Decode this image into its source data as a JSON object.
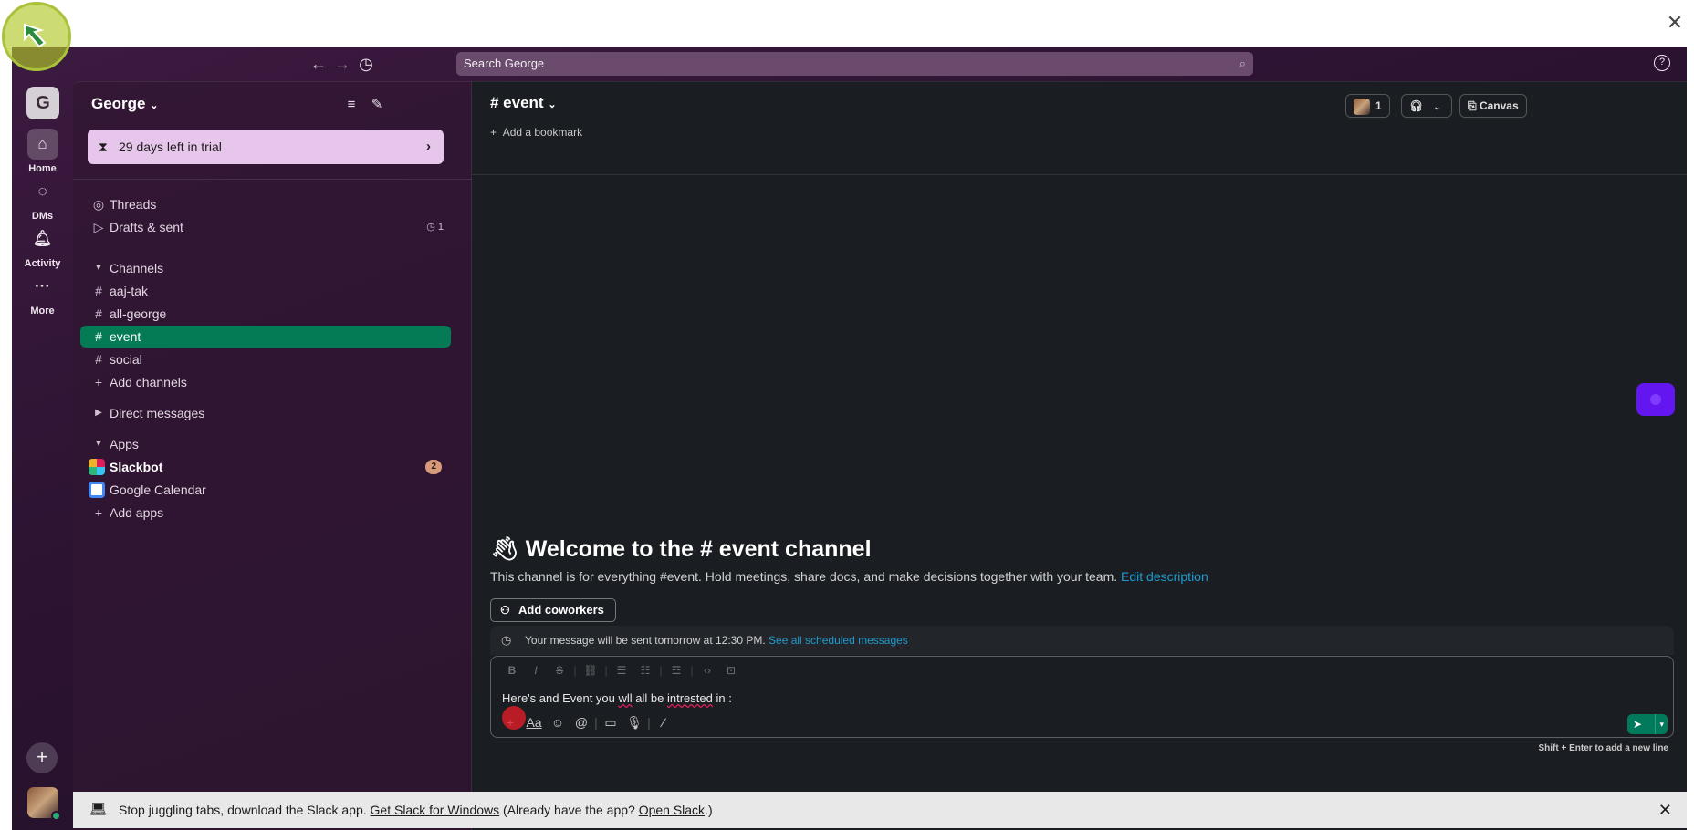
{
  "app": {
    "close_glyph": "✕",
    "help_glyph": "?"
  },
  "search": {
    "placeholder": "Search George"
  },
  "rail": {
    "workspace_initial": "G",
    "items": [
      {
        "label": "Home",
        "icon": "home-icon"
      },
      {
        "label": "DMs",
        "icon": "dms-icon"
      },
      {
        "label": "Activity",
        "icon": "bell-icon"
      },
      {
        "label": "More",
        "icon": "more-icon"
      }
    ],
    "add_glyph": "+"
  },
  "sidebar": {
    "workspace_name": "George",
    "trial_text": "29 days left in trial",
    "threads": "Threads",
    "drafts": "Drafts & sent",
    "drafts_count": "1",
    "channels_header": "Channels",
    "channels": [
      "aaj-tak",
      "all-george",
      "event",
      "social"
    ],
    "add_channels": "Add channels",
    "direct_messages": "Direct messages",
    "apps_header": "Apps",
    "apps": [
      {
        "name": "Slackbot",
        "badge": "2"
      },
      {
        "name": "Google Calendar"
      }
    ],
    "add_apps": "Add apps"
  },
  "main": {
    "channel_name": "# event",
    "add_bookmark": "Add a bookmark",
    "members_count": "1",
    "canvas_label": "Canvas",
    "welcome_title": "Welcome to the # event channel",
    "description": "This channel is for everything #event. Hold meetings, share docs, and make decisions together with your team.",
    "edit_description": "Edit description",
    "add_coworkers": "Add coworkers",
    "scheduled_text": "Your message will be sent tomorrow at 12:30 PM.",
    "scheduled_link": "See all scheduled messages",
    "message_prefix": "Here's and Event you ",
    "message_typo1": "wll",
    "message_mid": " all be ",
    "message_typo2": "intrested",
    "message_suffix": " in :",
    "hint": "Shift + Enter to add a new line"
  },
  "banner": {
    "text_before": "Stop juggling tabs, download the Slack app.",
    "link1": "Get Slack for Windows",
    "text_mid": "(Already have the app?",
    "link2": "Open Slack",
    "text_after": ".)"
  }
}
